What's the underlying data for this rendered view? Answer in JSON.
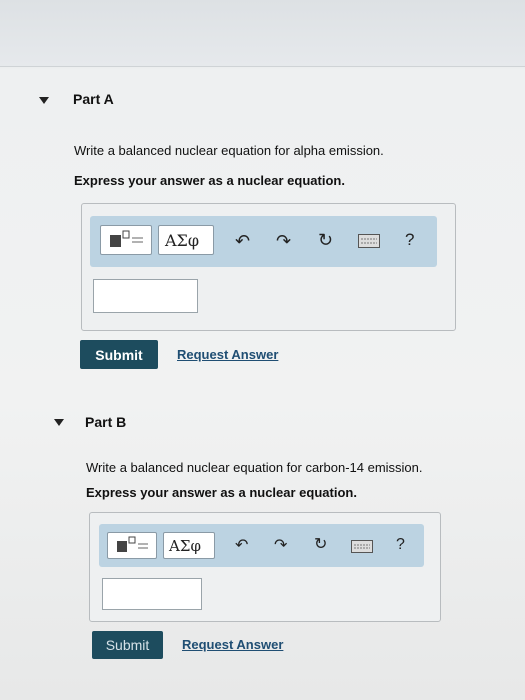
{
  "parts": [
    {
      "title": "Part A",
      "question": "Write a balanced nuclear equation for alpha emission.",
      "instruction": "Express your answer as a nuclear equation.",
      "symbols_label": "ΑΣφ",
      "help_label": "?",
      "submit_label": "Submit",
      "request_label": "Request Answer"
    },
    {
      "title": "Part B",
      "question": "Write a balanced nuclear equation for carbon-14 emission.",
      "instruction": "Express your answer as a nuclear equation.",
      "symbols_label": "ΑΣφ",
      "help_label": "?",
      "submit_label": "Submit",
      "request_label": "Request Answer"
    }
  ],
  "colors": {
    "submit_bg": "#1d4c5e",
    "toolbar_bg": "#bcd3e2",
    "link": "#1f4e73"
  },
  "icons": [
    "templates-icon",
    "undo-icon",
    "redo-icon",
    "reset-icon",
    "keyboard-icon",
    "help-icon",
    "collapse-triangle-icon"
  ]
}
